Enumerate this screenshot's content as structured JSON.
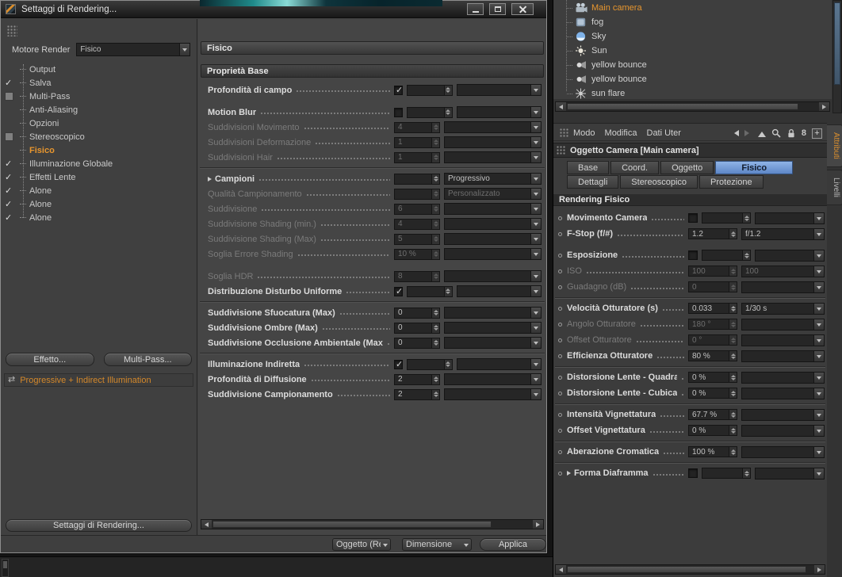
{
  "colors": {
    "accent_orange": "#e8962e",
    "active_tab_blue": "#6f9ad8"
  },
  "dialog": {
    "title": "Settaggi di Rendering...",
    "engine": {
      "label": "Motore Render",
      "value": "Fisico"
    },
    "tree": [
      {
        "label": "Output",
        "check": "none"
      },
      {
        "label": "Salva",
        "check": "checked"
      },
      {
        "label": "Multi-Pass",
        "check": "box"
      },
      {
        "label": "Anti-Aliasing",
        "check": "none"
      },
      {
        "label": "Opzioni",
        "check": "none"
      },
      {
        "label": "Stereoscopico",
        "check": "box"
      },
      {
        "label": "Fisico",
        "check": "none",
        "selected": true
      },
      {
        "label": "Illuminazione Globale",
        "check": "checked"
      },
      {
        "label": "Effetti Lente",
        "check": "checked"
      },
      {
        "label": "Alone",
        "check": "checked"
      },
      {
        "label": "Alone",
        "check": "checked"
      },
      {
        "label": "Alone",
        "check": "checked"
      }
    ],
    "effect_button": "Effetto...",
    "multipass_button": "Multi-Pass...",
    "preset": "Progressive + Indirect Illumination",
    "settings_button": "Settaggi di Rendering...",
    "panel": {
      "header": "Fisico",
      "section": "Proprietà Base",
      "rows": [
        {
          "type": "check",
          "label": "Profondità di campo",
          "checked": true
        },
        {
          "kind": "gap"
        },
        {
          "type": "check",
          "label": "Motion Blur"
        },
        {
          "type": "spin",
          "label": "Suddivisioni Movimento",
          "value": "4",
          "disabled": true
        },
        {
          "type": "spin",
          "label": "Suddivisioni Deformazione",
          "value": "1",
          "disabled": true
        },
        {
          "type": "spin",
          "label": "Suddivisioni Hair",
          "value": "1",
          "disabled": true
        },
        {
          "kind": "sep"
        },
        {
          "type": "drop",
          "label": "Campioni",
          "drop": "Progressivo",
          "expand": true
        },
        {
          "type": "drop",
          "label": "Qualità Campionamento",
          "drop": "Personalizzato",
          "disabled": true
        },
        {
          "type": "spin",
          "label": "Suddivisione",
          "value": "6",
          "disabled": true
        },
        {
          "type": "spin",
          "label": "Suddivisione Shading (min.)",
          "value": "4",
          "disabled": true
        },
        {
          "type": "spin",
          "label": "Suddivisione Shading (Max)",
          "value": "5",
          "disabled": true
        },
        {
          "type": "spin",
          "label": "Soglia Errore Shading",
          "value": "10 %",
          "disabled": true
        },
        {
          "kind": "gap"
        },
        {
          "type": "spin",
          "label": "Soglia HDR",
          "value": "8",
          "disabled": true
        },
        {
          "type": "check",
          "label": "Distribuzione Disturbo Uniforme",
          "checked": true
        },
        {
          "kind": "sep"
        },
        {
          "type": "spin",
          "label": "Suddivisione Sfuocatura (Max)",
          "value": "0"
        },
        {
          "type": "spin",
          "label": "Suddivisione Ombre (Max)",
          "value": "0"
        },
        {
          "type": "spin",
          "label": "Suddivisione Occlusione Ambientale (Max)",
          "value": "0"
        },
        {
          "kind": "sep"
        },
        {
          "type": "check",
          "label": "Illuminazione Indiretta",
          "checked": true
        },
        {
          "type": "spin",
          "label": "Profondità di Diffusione",
          "value": "2"
        },
        {
          "type": "spin",
          "label": "Suddivisione Campionamento",
          "value": "2"
        }
      ]
    },
    "footer": {
      "object": "Oggetto (Re",
      "dimension": "Dimensione",
      "apply": "Applica"
    }
  },
  "object_manager": {
    "items": [
      {
        "name": "Main camera",
        "icon": "camera",
        "active": true
      },
      {
        "name": "fog",
        "icon": "fog"
      },
      {
        "name": "Sky",
        "icon": "sky"
      },
      {
        "name": "Sun",
        "icon": "sun"
      },
      {
        "name": "yellow bounce",
        "icon": "light"
      },
      {
        "name": "yellow bounce",
        "icon": "light"
      },
      {
        "name": "sun flare",
        "icon": "flare"
      }
    ]
  },
  "attribute_manager": {
    "menu": {
      "modo": "Modo",
      "modifica": "Modifica",
      "dati": "Dati Uter"
    },
    "title": "Oggetto Camera [Main camera]",
    "tabs_row1": [
      {
        "label": "Base"
      },
      {
        "label": "Coord."
      },
      {
        "label": "Oggetto"
      },
      {
        "label": "Fisico",
        "active": true
      }
    ],
    "tabs_row2": [
      {
        "label": "Dettagli"
      },
      {
        "label": "Stereoscopico"
      },
      {
        "label": "Protezione"
      }
    ],
    "section": "Rendering Fisico",
    "rows": [
      {
        "type": "check",
        "label": "Movimento Camera"
      },
      {
        "type": "spindrop",
        "label": "F-Stop (f/#)",
        "value": "1.2",
        "drop": "f/1.2"
      },
      {
        "kind": "gap"
      },
      {
        "type": "check",
        "label": "Esposizione"
      },
      {
        "type": "spindrop",
        "label": "ISO",
        "value": "100",
        "drop": "100",
        "disabled": true
      },
      {
        "type": "spin",
        "label": "Guadagno (dB)",
        "value": "0",
        "disabled": true
      },
      {
        "kind": "sep"
      },
      {
        "type": "spindrop",
        "label": "Velocità Otturatore (s)",
        "value": "0.033",
        "drop": "1/30 s"
      },
      {
        "type": "spin",
        "label": "Angolo Otturatore",
        "value": "180 °",
        "disabled": true
      },
      {
        "type": "spin",
        "label": "Offset Otturatore",
        "value": "0 °",
        "disabled": true
      },
      {
        "type": "spin",
        "label": "Efficienza Otturatore",
        "value": "80 %"
      },
      {
        "kind": "sep"
      },
      {
        "type": "spin",
        "label": "Distorsione Lente - Quadratica",
        "value": "0 %"
      },
      {
        "type": "spin",
        "label": "Distorsione Lente - Cubica",
        "value": "0 %"
      },
      {
        "kind": "sep"
      },
      {
        "type": "spin",
        "label": "Intensità Vignettatura",
        "value": "67.7 %"
      },
      {
        "type": "spin",
        "label": "Offset Vignettatura",
        "value": "0 %"
      },
      {
        "kind": "sep"
      },
      {
        "type": "spin",
        "label": "Aberazione Cromatica",
        "value": "100 %"
      },
      {
        "kind": "sep"
      },
      {
        "type": "check",
        "label": "Forma Diaframma",
        "expand": true
      }
    ]
  },
  "side_tabs": [
    {
      "label": "Attributi",
      "active": true
    },
    {
      "label": "Livelli"
    }
  ]
}
